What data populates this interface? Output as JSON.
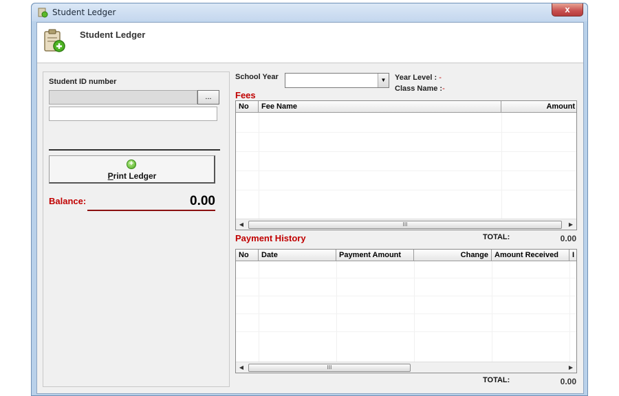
{
  "window": {
    "title": "Student Ledger",
    "close_glyph": "x"
  },
  "header": {
    "title": "Student Ledger",
    "icon": "clipboard-add-icon"
  },
  "left_panel": {
    "student_id_label": "Student ID number",
    "student_id_value": "",
    "student_name_value": "",
    "browse_label": "...",
    "print_button_prefix": "P",
    "print_button_rest": "rint Ledger",
    "balance_label": "Balance:",
    "balance_value": "0.00"
  },
  "filters": {
    "school_year_label": "School Year",
    "school_year_value": "",
    "year_level_label": "Year Level :",
    "year_level_value": "-",
    "class_name_label": "Class Name :",
    "class_name_value": "-"
  },
  "fees": {
    "title": "Fees",
    "columns": [
      "No",
      "Fee Name",
      "Amount"
    ],
    "rows": [],
    "total_label": "TOTAL:",
    "total_value": "0.00"
  },
  "payment_history": {
    "title": "Payment History",
    "columns": [
      "No",
      "Date",
      "Payment Amount",
      "Change",
      "Amount Received",
      "I"
    ],
    "rows": [],
    "total_label": "TOTAL:",
    "total_value": "0.00"
  },
  "colors": {
    "accent_red": "#c00000",
    "balance_line": "#8b1010"
  }
}
